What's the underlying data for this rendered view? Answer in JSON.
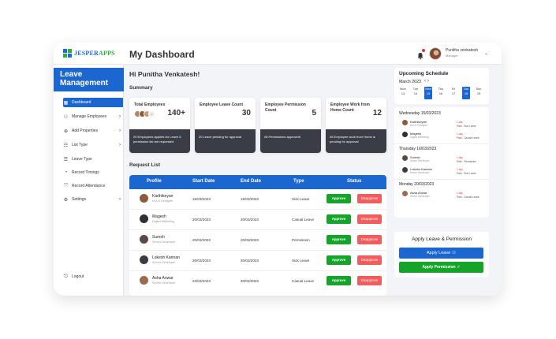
{
  "brand": {
    "name_a": "JESPER",
    "name_b": "APPS"
  },
  "header": {
    "page_title": "My Dashboard",
    "user_name": "Punitha venkatesh",
    "user_role": "Manager"
  },
  "sidebar": {
    "title_line1": "Leave",
    "title_line2": "Management",
    "items": [
      {
        "label": "Dashboard",
        "icon": "dashboard-icon"
      },
      {
        "label": "Manage Employees",
        "icon": "users-icon"
      },
      {
        "label": "Add Properties",
        "icon": "plus-circle-icon"
      },
      {
        "label": "List Type",
        "icon": "list-icon"
      },
      {
        "label": "Leave Type",
        "icon": "lines-icon"
      },
      {
        "label": "Record Timings",
        "icon": "clock-icon"
      },
      {
        "label": "Record Attendance",
        "icon": "expand-icon"
      },
      {
        "label": "Settings",
        "icon": "gear-icon"
      }
    ],
    "logout": "Logout"
  },
  "main": {
    "greeting": "Hi Punitha Venkatesh!",
    "summary_label": "Summary",
    "cards": [
      {
        "title": "Total Employees",
        "value": "140+",
        "footer": "20 Employees applied for Leave 5 permission list are requested"
      },
      {
        "title": "Employee Leave Count",
        "value": "30",
        "footer": "20 Leave pending for approval"
      },
      {
        "title": "Employee Permission Count",
        "value": "5",
        "footer": "All Permissions approved!"
      },
      {
        "title": "Employee Work from Home Count",
        "value": "12",
        "footer": "05 Employee work from Home is pending for approval"
      }
    ],
    "request_list_label": "Request List",
    "table": {
      "headers": [
        "Profile",
        "Start Date",
        "End Date",
        "Type",
        "Status"
      ],
      "approve_label": "Approve",
      "disapprove_label": "Disapprove",
      "rows": [
        {
          "name": "Karthikeyan",
          "role": "UI/UX Designer",
          "start": "15/03/2023",
          "end": "15/03/2023",
          "type": "Sick Leave"
        },
        {
          "name": "Magesh",
          "role": "Digital Marketing",
          "start": "20/03/2023",
          "end": "20/03/2023",
          "type": "Casual Leave"
        },
        {
          "name": "Suresh",
          "role": "Senior Developer",
          "start": "20/03/2023",
          "end": "20/03/2023",
          "type": "Permission"
        },
        {
          "name": "Lokesh Kannan",
          "role": "Senior Developer",
          "start": "20/03/2023",
          "end": "20/03/2023",
          "type": "Sick Leave"
        },
        {
          "name": "Asha Anwar",
          "role": "Senior Developer",
          "start": "24/03/2023",
          "end": "20/03/2023",
          "type": "Casual Leave"
        }
      ]
    }
  },
  "schedule": {
    "title": "Upcoming Schedule",
    "month": "March 2023",
    "days": [
      {
        "d": "Mon",
        "n": "13"
      },
      {
        "d": "Tue",
        "n": "14"
      },
      {
        "d": "Wed",
        "n": "15"
      },
      {
        "d": "Thu",
        "n": "16"
      },
      {
        "d": "Fri",
        "n": "17"
      },
      {
        "d": "Sat",
        "n": "18"
      },
      {
        "d": "Sun",
        "n": "19"
      }
    ],
    "groups": [
      {
        "day": "Wednesday 15/03/2023",
        "entries": [
          {
            "name": "Karthikeyan",
            "role": "UI/UX Designer",
            "days": "1 day",
            "type": "Paid - Sick Leave"
          },
          {
            "name": "Magesh",
            "role": "Digital Marketing",
            "days": "1 day",
            "type": "Paid - Casual Leave"
          }
        ]
      },
      {
        "day": "Thursday 16/03/2023",
        "entries": [
          {
            "name": "Suresh",
            "role": "Senior Developer",
            "days": "1 day",
            "type": "Paid - Permission"
          },
          {
            "name": "Lokesh Kannan",
            "role": "Senior Developer",
            "days": "1 day",
            "type": "Paid - Sick Leave"
          }
        ]
      },
      {
        "day": "Monday 20/03/2023",
        "entries": [
          {
            "name": "Asha Anwar",
            "role": "Senior Developer",
            "days": "1 day",
            "type": "Paid - Casual Leave"
          }
        ]
      }
    ]
  },
  "apply": {
    "title": "Apply Leave & Permission",
    "leave_button": "Apply Leave",
    "permission_button": "Apply Permission"
  },
  "colors": {
    "primary": "#1c66d0",
    "success": "#15a32a",
    "danger": "#f25c5c",
    "dark": "#3a3d45"
  }
}
